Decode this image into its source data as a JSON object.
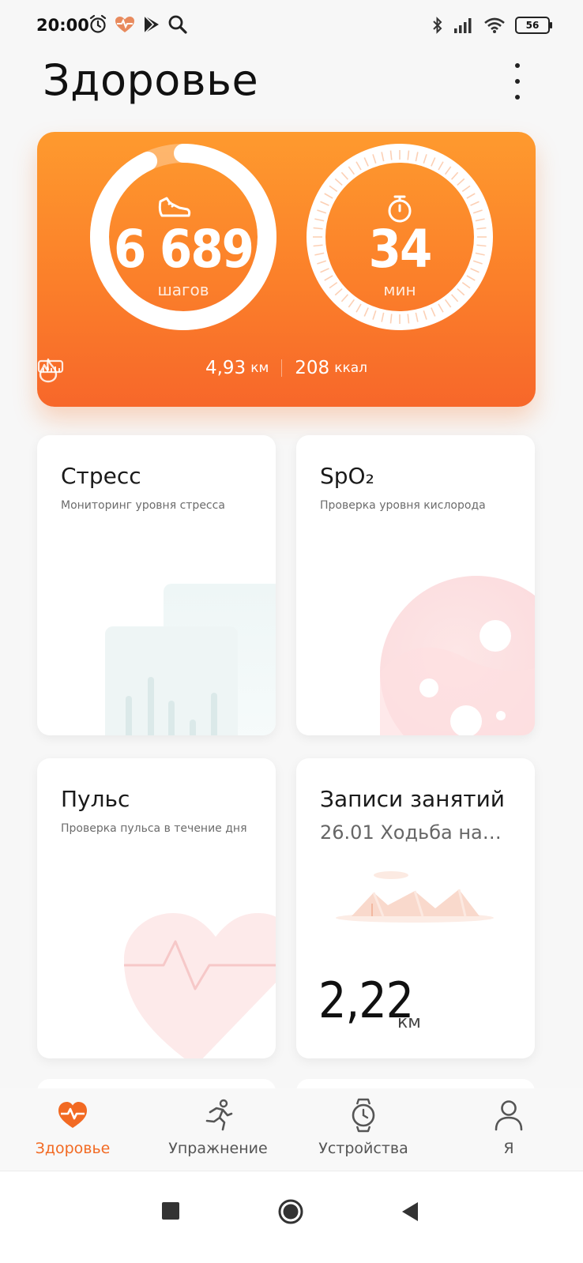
{
  "status_bar": {
    "time": "20:00",
    "left_icons": [
      "alarm-icon",
      "heart-rate-icon",
      "play-store-icon",
      "search-icon"
    ],
    "right_icons": [
      "bluetooth-icon",
      "signal-icon",
      "wifi-icon"
    ],
    "battery": "56"
  },
  "header": {
    "title": "Здоровье",
    "menu_icon": "more-vertical-icon"
  },
  "activity": {
    "steps_value": "6 689",
    "steps_unit": "шагов",
    "steps_progress": 0.93,
    "minutes_value": "34",
    "minutes_unit": "мин",
    "minutes_progress": 1.0,
    "distance_value": "4,93",
    "distance_unit": "км",
    "calories_value": "208",
    "calories_unit": "ккал",
    "colors": {
      "start": "#fe9a2e",
      "end": "#f7672a"
    }
  },
  "tiles": {
    "stress": {
      "title": "Стресс",
      "subtitle": "Мониторинг уровня стресса"
    },
    "spo2": {
      "title": "SpO₂",
      "subtitle": "Проверка уровня кислорода"
    },
    "pulse": {
      "title": "Пульс",
      "subtitle": "Проверка пульса в течение дня"
    },
    "workouts": {
      "title": "Записи занятий",
      "subtitle": "26.01 Ходьба на…",
      "value": "2,22",
      "unit": "км"
    }
  },
  "bottom_nav": {
    "items": [
      {
        "label": "Здоровье",
        "icon": "heart-pulse-icon",
        "active": true
      },
      {
        "label": "Упражнение",
        "icon": "running-icon",
        "active": false
      },
      {
        "label": "Устройства",
        "icon": "watch-icon",
        "active": false
      },
      {
        "label": "Я",
        "icon": "person-icon",
        "active": false
      }
    ],
    "accent": "#f26a23"
  },
  "system_nav": {
    "icons": [
      "recent-apps-icon",
      "home-icon",
      "back-icon"
    ]
  }
}
